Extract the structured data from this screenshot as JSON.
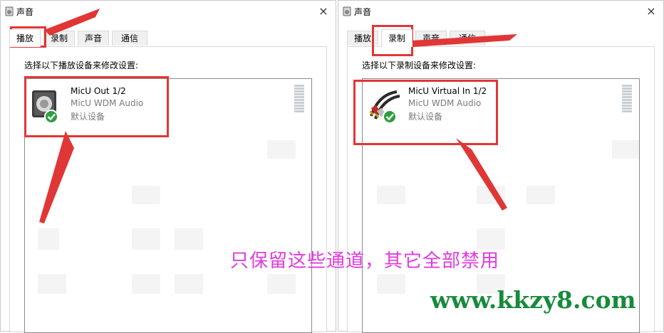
{
  "left_dialog": {
    "title": "声音",
    "close": "×",
    "tabs": [
      "播放",
      "录制",
      "声音",
      "通信"
    ],
    "active_tab": "播放",
    "instruction": "选择以下播放设备来修改设置:",
    "device": {
      "name": "MicU Out 1/2",
      "driver": "MicU WDM Audio",
      "status": "默认设备",
      "icon": "speaker-icon",
      "status_icon": "default-check-icon"
    }
  },
  "right_dialog": {
    "title": "声音",
    "close": "×",
    "tabs": [
      "播放",
      "录制",
      "声音",
      "通信"
    ],
    "active_tab": "录制",
    "instruction": "选择以下录制设备来修改设置:",
    "device": {
      "name": "MicU Virtual In 1/2",
      "driver": "MicU WDM Audio",
      "status": "默认设备",
      "icon": "rca-cable-icon",
      "status_icon": "default-check-icon"
    }
  },
  "annotation": {
    "caption": "只保留这些通道，其它全部禁用",
    "caption_color": "#e13ae0",
    "highlight_color": "#e13636"
  },
  "watermark": {
    "text": "www.kkzy8.com",
    "color": "#178a3c"
  },
  "colors": {
    "check_green": "#2e9e3f",
    "meter_gray": "#c8cfd4"
  }
}
